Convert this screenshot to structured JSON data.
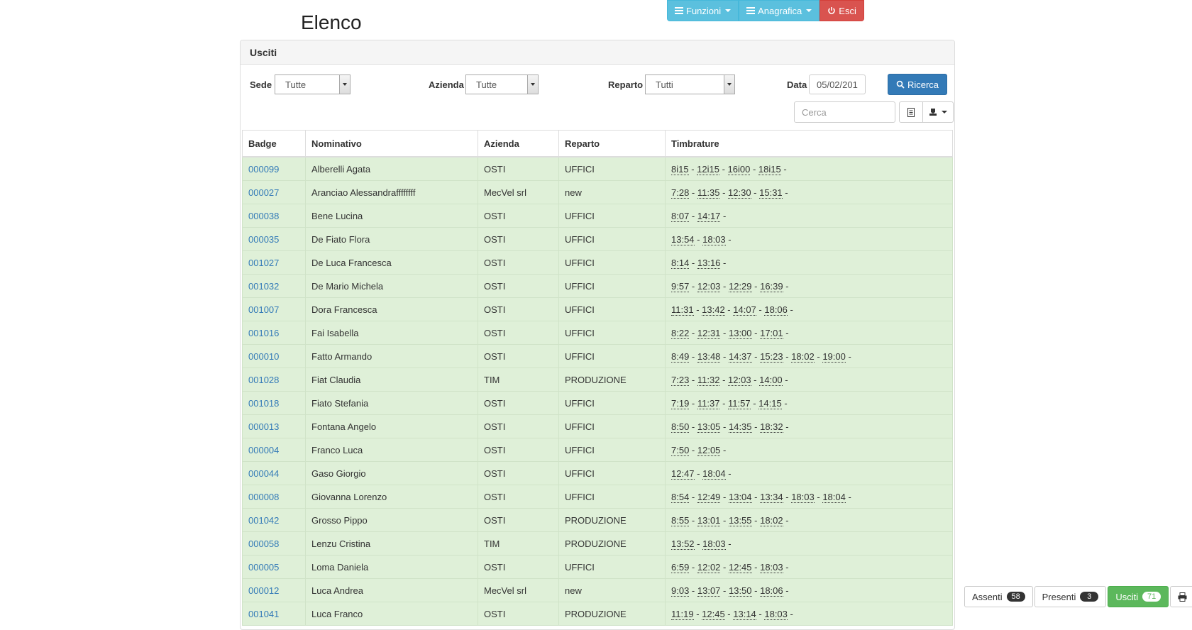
{
  "page": {
    "title": "Elenco"
  },
  "topbar": {
    "funzioni_label": "Funzioni",
    "anagrafica_label": "Anagrafica",
    "esci_label": "Esci"
  },
  "panel": {
    "title": "Usciti"
  },
  "filters": {
    "sede_label": "Sede",
    "sede_value": "Tutte",
    "azienda_label": "Azienda",
    "azienda_value": "Tutte",
    "reparto_label": "Reparto",
    "reparto_value": "Tutti",
    "data_label": "Data",
    "data_value": "05/02/201",
    "ricerca_label": "Ricerca",
    "cerca_placeholder": "Cerca"
  },
  "table": {
    "headers": [
      "Badge",
      "Nominativo",
      "Azienda",
      "Reparto",
      "Timbrature"
    ],
    "rows": [
      {
        "badge": "000099",
        "nome": "Alberelli Agata",
        "azienda": "OSTI",
        "reparto": "UFFICI",
        "timbrature": [
          "8i15",
          "12i15",
          "16i00",
          "18i15"
        ]
      },
      {
        "badge": "000027",
        "nome": "Aranciao Alessandraffffffff",
        "azienda": "MecVel srl",
        "reparto": "new",
        "timbrature": [
          "7:28",
          "11:35",
          "12:30",
          "15:31"
        ]
      },
      {
        "badge": "000038",
        "nome": "Bene Lucina",
        "azienda": "OSTI",
        "reparto": "UFFICI",
        "timbrature": [
          "8:07",
          "14:17"
        ]
      },
      {
        "badge": "000035",
        "nome": "De Fiato Flora",
        "azienda": "OSTI",
        "reparto": "UFFICI",
        "timbrature": [
          "13:54",
          "18:03"
        ]
      },
      {
        "badge": "001027",
        "nome": "De Luca Francesca",
        "azienda": "OSTI",
        "reparto": "UFFICI",
        "timbrature": [
          "8:14",
          "13:16"
        ]
      },
      {
        "badge": "001032",
        "nome": "De Mario Michela",
        "azienda": "OSTI",
        "reparto": "UFFICI",
        "timbrature": [
          "9:57",
          "12:03",
          "12:29",
          "16:39"
        ]
      },
      {
        "badge": "001007",
        "nome": "Dora Francesca",
        "azienda": "OSTI",
        "reparto": "UFFICI",
        "timbrature": [
          "11:31",
          "13:42",
          "14:07",
          "18:06"
        ]
      },
      {
        "badge": "001016",
        "nome": "Fai Isabella",
        "azienda": "OSTI",
        "reparto": "UFFICI",
        "timbrature": [
          "8:22",
          "12:31",
          "13:00",
          "17:01"
        ]
      },
      {
        "badge": "000010",
        "nome": "Fatto Armando",
        "azienda": "OSTI",
        "reparto": "UFFICI",
        "timbrature": [
          "8:49",
          "13:48",
          "14:37",
          "15:23",
          "18:02",
          "19:00"
        ]
      },
      {
        "badge": "001028",
        "nome": "Fiat Claudia",
        "azienda": "TIM",
        "reparto": "PRODUZIONE",
        "timbrature": [
          "7:23",
          "11:32",
          "12:03",
          "14:00"
        ]
      },
      {
        "badge": "001018",
        "nome": "Fiato Stefania",
        "azienda": "OSTI",
        "reparto": "UFFICI",
        "timbrature": [
          "7:19",
          "11:37",
          "11:57",
          "14:15"
        ]
      },
      {
        "badge": "000013",
        "nome": "Fontana Angelo",
        "azienda": "OSTI",
        "reparto": "UFFICI",
        "timbrature": [
          "8:50",
          "13:05",
          "14:35",
          "18:32"
        ]
      },
      {
        "badge": "000004",
        "nome": "Franco Luca",
        "azienda": "OSTI",
        "reparto": "UFFICI",
        "timbrature": [
          "7:50",
          "12:05"
        ]
      },
      {
        "badge": "000044",
        "nome": "Gaso Giorgio",
        "azienda": "OSTI",
        "reparto": "UFFICI",
        "timbrature": [
          "12:47",
          "18:04"
        ]
      },
      {
        "badge": "000008",
        "nome": "Giovanna Lorenzo",
        "azienda": "OSTI",
        "reparto": "UFFICI",
        "timbrature": [
          "8:54",
          "12:49",
          "13:04",
          "13:34",
          "18:03",
          "18:04"
        ]
      },
      {
        "badge": "001042",
        "nome": "Grosso Pippo",
        "azienda": "OSTI",
        "reparto": "PRODUZIONE",
        "timbrature": [
          "8:55",
          "13:01",
          "13:55",
          "18:02"
        ]
      },
      {
        "badge": "000058",
        "nome": "Lenzu Cristina",
        "azienda": "TIM",
        "reparto": "PRODUZIONE",
        "timbrature": [
          "13:52",
          "18:03"
        ]
      },
      {
        "badge": "000005",
        "nome": "Loma Daniela",
        "azienda": "OSTI",
        "reparto": "UFFICI",
        "timbrature": [
          "6:59",
          "12:02",
          "12:45",
          "18:03"
        ]
      },
      {
        "badge": "000012",
        "nome": "Luca Andrea",
        "azienda": "MecVel srl",
        "reparto": "new",
        "timbrature": [
          "9:03",
          "13:07",
          "13:50",
          "18:06"
        ]
      },
      {
        "badge": "001041",
        "nome": "Luca Franco",
        "azienda": "OSTI",
        "reparto": "PRODUZIONE",
        "timbrature": [
          "11:19",
          "12:45",
          "13:14",
          "18:03"
        ]
      }
    ]
  },
  "bottom": {
    "assenti_label": "Assenti",
    "assenti_count": "58",
    "presenti_label": "Presenti",
    "presenti_count": "3",
    "usciti_label": "Usciti",
    "usciti_count": "71"
  },
  "colors": {
    "row_success": "#dff0d8",
    "primary": "#337ab7",
    "info": "#5bc0de",
    "danger": "#d9534f",
    "success": "#5cb85c"
  }
}
